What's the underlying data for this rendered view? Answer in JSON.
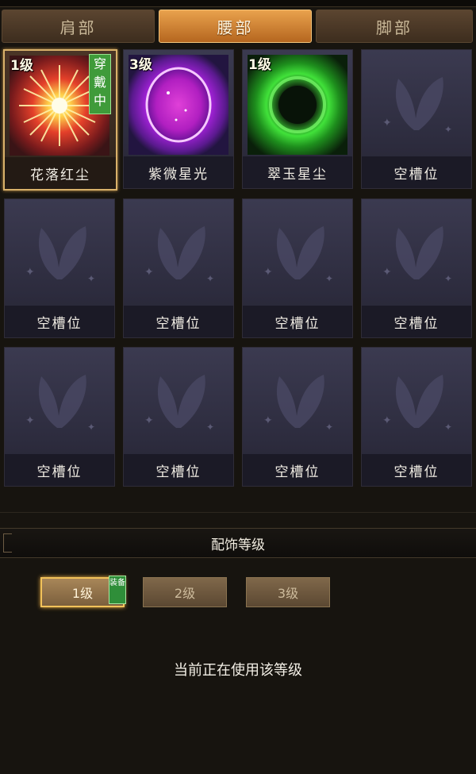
{
  "tabs": [
    {
      "label": "肩部",
      "active": false
    },
    {
      "label": "腰部",
      "active": true
    },
    {
      "label": "脚部",
      "active": false
    }
  ],
  "slots": [
    {
      "name": "花落红尘",
      "level": "1级",
      "badge": "穿戴中",
      "gem": "red-starburst",
      "equipped": true
    },
    {
      "name": "紫微星光",
      "level": "3级",
      "badge": "",
      "gem": "purple-orb",
      "equipped": false
    },
    {
      "name": "翠玉星尘",
      "level": "1级",
      "badge": "",
      "gem": "green-ring",
      "equipped": false
    },
    {
      "name": "空槽位",
      "level": "",
      "badge": "",
      "gem": "butterfly-placeholder",
      "equipped": false
    },
    {
      "name": "空槽位"
    },
    {
      "name": "空槽位"
    },
    {
      "name": "空槽位"
    },
    {
      "name": "空槽位"
    },
    {
      "name": "空槽位"
    },
    {
      "name": "空槽位"
    },
    {
      "name": "空槽位"
    },
    {
      "name": "空槽位"
    }
  ],
  "level_section": {
    "title": "配饰等级",
    "buttons": [
      {
        "label": "1级",
        "active": true
      },
      {
        "label": "2级",
        "active": false
      },
      {
        "label": "3级",
        "active": false
      }
    ],
    "equip_tag": "装备",
    "status_text": "当前正在使用该等级"
  },
  "colors": {
    "tab_active": "#d98a35",
    "badge_green": "#3f9b3a",
    "slot_bg": "#34334a"
  }
}
